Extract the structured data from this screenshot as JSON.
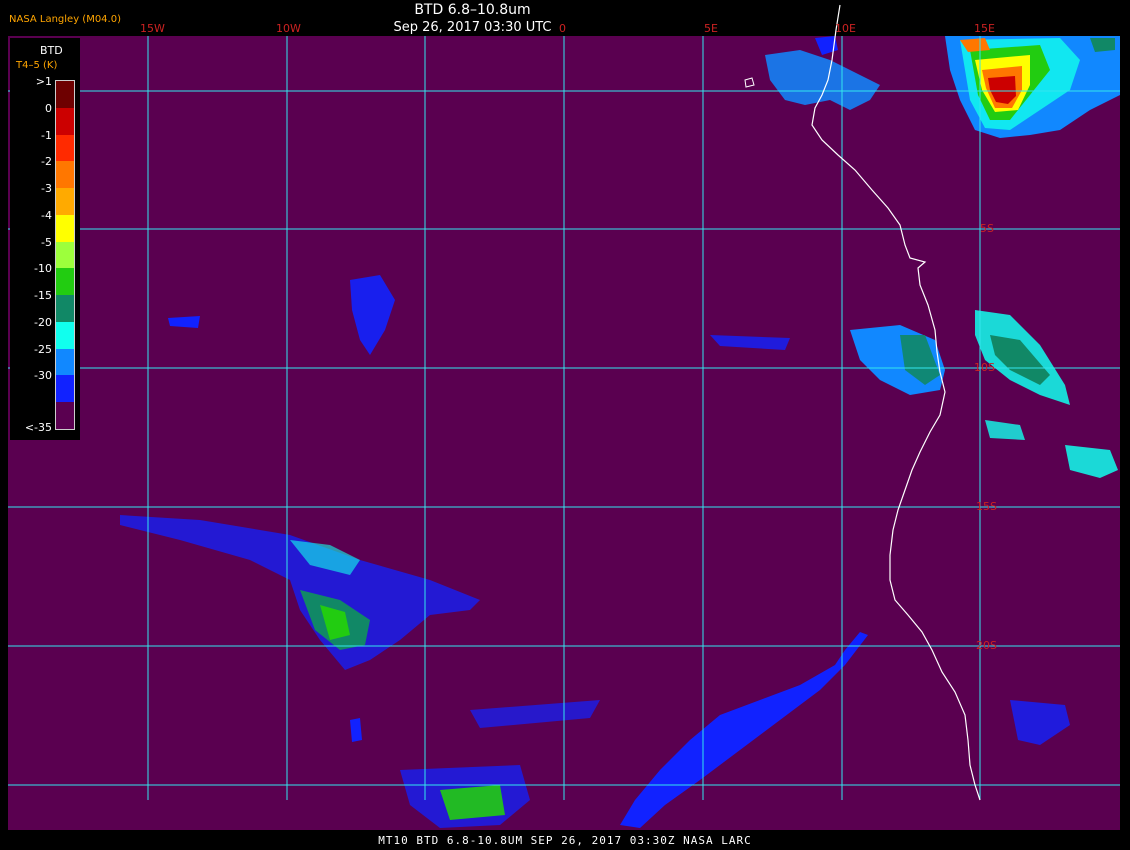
{
  "header": {
    "title": "BTD 6.8–10.8um",
    "subtitle": "Sep 26, 2017 03:30 UTC",
    "agency": "NASA Langley (M04.0)"
  },
  "footer": {
    "text": "MT10  BTD 6.8-10.8UM  SEP 26, 2017 03:30Z  NASA LARC"
  },
  "legend": {
    "title": "BTD",
    "subtitle": "T4–5 (K)",
    "ticks": [
      ">1",
      "0",
      "-1",
      "-2",
      "-3",
      "-4",
      "-5",
      "-10",
      "-15",
      "-20",
      "-25",
      "-30",
      "<-35"
    ],
    "colors": [
      "#6e0000",
      "#cc0000",
      "#ff2a00",
      "#ff7700",
      "#ffaa00",
      "#ffff00",
      "#9dff3c",
      "#22cc11",
      "#118866",
      "#11ffee",
      "#1188ff",
      "#1122ff",
      "#5a0050"
    ]
  },
  "map": {
    "background_color": "#5a0050",
    "grid_color": "#33e6ee",
    "coast_color": "#ffffff",
    "lon_labels": [
      "15W",
      "10W",
      "5W",
      "0",
      "5E",
      "10E",
      "15E"
    ],
    "lat_labels": [
      "5S",
      "10S",
      "15S",
      "20S"
    ],
    "label_color": "#cc2222"
  }
}
